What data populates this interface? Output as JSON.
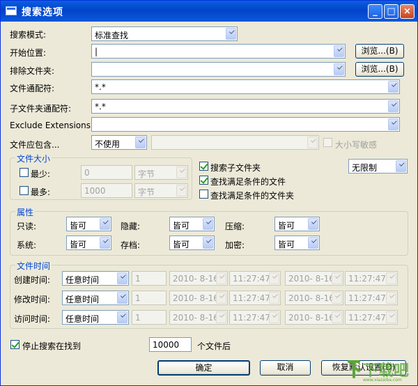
{
  "window": {
    "title": "搜索选项"
  },
  "search_mode": {
    "label": "搜索模式:",
    "value": "标准查找"
  },
  "start_location": {
    "label": "开始位置:",
    "value": "|",
    "browse_label": "浏览...(B)"
  },
  "exclude_folder": {
    "label": "排除文件夹:",
    "value": "",
    "browse_label": "浏览...(B)"
  },
  "file_wildcard": {
    "label": "文件通配符:",
    "value": "*.*"
  },
  "subfolder_wildcard": {
    "label": "子文件夹通配符:",
    "value": "*.*"
  },
  "exclude_extensions": {
    "label": "Exclude Extensions:",
    "value": ""
  },
  "file_contains": {
    "label": "文件应包含...",
    "mode": "不使用",
    "text": "",
    "case_sensitive_label": "大小写敏感"
  },
  "file_size": {
    "title": "文件大小",
    "min": {
      "label": "最少:",
      "value": "0",
      "unit": "字节"
    },
    "max": {
      "label": "最多:",
      "value": "1000",
      "unit": "字节"
    }
  },
  "options": {
    "search_subfolders": "搜索子文件夹",
    "depth": "无限制",
    "find_files": "查找满足条件的文件",
    "find_folders": "查找满足条件的文件夹"
  },
  "attributes": {
    "title": "属性",
    "readonly": {
      "label": "只读:",
      "value": "皆可"
    },
    "hidden": {
      "label": "隐藏:",
      "value": "皆可"
    },
    "compressed": {
      "label": "压缩:",
      "value": "皆可"
    },
    "system": {
      "label": "系统:",
      "value": "皆可"
    },
    "archive": {
      "label": "存档:",
      "value": "皆可"
    },
    "encrypted": {
      "label": "加密:",
      "value": "皆可"
    }
  },
  "file_time": {
    "title": "文件时间",
    "rows": [
      {
        "label": "创建时间:",
        "mode": "任意时间",
        "num": "1",
        "date1": "2010- 8-16",
        "time1": "11:27:47",
        "date2": "2010- 8-16",
        "time2": "11:27:47"
      },
      {
        "label": "修改时间:",
        "mode": "任意时间",
        "num": "1",
        "date1": "2010- 8-16",
        "time1": "11:27:47",
        "date2": "2010- 8-16",
        "time2": "11:27:47"
      },
      {
        "label": "访问时间:",
        "mode": "任意时间",
        "num": "1",
        "date1": "2010- 8-16",
        "time1": "11:27:47",
        "date2": "2010- 8-16",
        "time2": "11:27:47"
      }
    ]
  },
  "stop_search": {
    "label": "停止搜索在找到",
    "count": "10000",
    "suffix": "个文件后"
  },
  "buttons": {
    "ok": "确定",
    "cancel": "取消",
    "restore": "恢复默认设置(D)"
  },
  "watermark": {
    "text": "下载吧",
    "url": "www.xiazaiba.com"
  }
}
